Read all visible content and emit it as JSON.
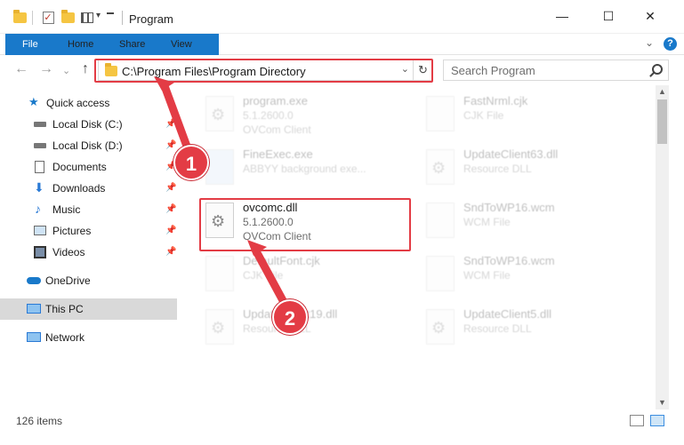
{
  "window": {
    "title": "Program",
    "minimize_glyph": "—",
    "maximize_glyph": "☐",
    "close_glyph": "✕",
    "title_dropdown_glyph": "▾"
  },
  "ribbon": {
    "tabs": [
      "File",
      "Home",
      "Share",
      "View"
    ],
    "help_glyph": "?",
    "collapse_glyph": "⌄"
  },
  "nav": {
    "back_glyph": "←",
    "forward_glyph": "→",
    "recent_glyph": "⌄",
    "up_glyph": "↑",
    "address": "C:\\Program Files\\Program Directory",
    "address_dropdown_glyph": "⌄",
    "refresh_glyph": "↻",
    "search_placeholder": "Search Program"
  },
  "sidebar": {
    "items": [
      {
        "label": "Quick access",
        "icon": "star-icon"
      },
      {
        "label": "Local Disk (C:)",
        "icon": "drive-icon",
        "pinned": true
      },
      {
        "label": "Local Disk (D:)",
        "icon": "drive-icon",
        "pinned": true
      },
      {
        "label": "Documents",
        "icon": "documents-icon",
        "pinned": true
      },
      {
        "label": "Downloads",
        "icon": "download-icon",
        "pinned": true
      },
      {
        "label": "Music",
        "icon": "music-icon",
        "pinned": true
      },
      {
        "label": "Pictures",
        "icon": "pictures-icon",
        "pinned": true
      },
      {
        "label": "Videos",
        "icon": "videos-icon",
        "pinned": true
      },
      {
        "label": "OneDrive",
        "icon": "cloud-icon"
      },
      {
        "label": "This PC",
        "icon": "computer-icon",
        "selected": true
      },
      {
        "label": "Network",
        "icon": "network-icon"
      }
    ],
    "pin_glyph": "📌"
  },
  "files": [
    {
      "name": "program.exe",
      "line1": "5.1.2600.0",
      "line2": "OVCom Client",
      "dim": true
    },
    {
      "name": "FastNrml.cjk",
      "line1": "CJK File",
      "line2": "",
      "dim": true
    },
    {
      "name": "FineExec.exe",
      "line1": "ABBYY background exe...",
      "line2": "",
      "dim": true
    },
    {
      "name": "UpdateClient63.dll",
      "line1": "Resource DLL",
      "line2": "",
      "dim": true
    },
    {
      "name": "ovcomc.dll",
      "line1": "5.1.2600.0",
      "line2": "OVCom Client",
      "dim": false
    },
    {
      "name": "SndToWP16.wcm",
      "line1": "WCM File",
      "line2": "",
      "dim": true
    },
    {
      "name": "DefaultFont.cjk",
      "line1": "CJK File",
      "line2": "",
      "dim": true
    },
    {
      "name": "SndToWP16.wcm",
      "line1": "WCM File",
      "line2": "",
      "dim": true
    },
    {
      "name": "UpdateClient19.dll",
      "line1": "Resource DLL",
      "line2": "",
      "dim": true
    },
    {
      "name": "UpdateClient5.dll",
      "line1": "Resource DLL",
      "line2": "",
      "dim": true
    }
  ],
  "status": {
    "item_count": "126 items"
  },
  "callouts": {
    "step1": "1",
    "step2": "2"
  },
  "colors": {
    "accent": "#1979ca",
    "highlight": "#e33c45",
    "selected": "#d9d9d9"
  }
}
